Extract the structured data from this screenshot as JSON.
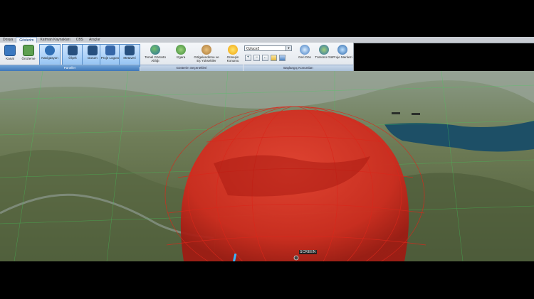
{
  "tabs": [
    "Dosya",
    "Gösterim",
    "Katman Kaynakları",
    "CBS",
    "Araçlar"
  ],
  "ribbon": {
    "kanal": "Kanal",
    "onizleme": "Önizleme",
    "navigasyon": "Navigasyon",
    "olcek": "Ölçek",
    "durum": "Durum",
    "proje_logosu": "Proje Logosu",
    "metaveri": "Metaveri",
    "group_paneller": "Paneller",
    "temel_goruntu": "Temel Görüntü Altlığı",
    "izgara": "Izgara",
    "golgelendirme": "Gölgelendirme ve Eş Yükseltiler",
    "gunesin_konumu": "Güneşin Konumu",
    "group_gosterim": "Gösterim Seçenekleri",
    "combo_value": "Ozluce2",
    "geri_don": "Geri Dön",
    "tumunu_gor": "Tümünü Gör",
    "proje_merkezi": "Proje Merkezi",
    "group_baslangic": "Başlangıç Konumları"
  },
  "viewport": {
    "screen_label": "SCREEN"
  },
  "colors": {
    "dome": "#d8281c",
    "grid": "#3fd05a",
    "water": "#1d4f66"
  }
}
